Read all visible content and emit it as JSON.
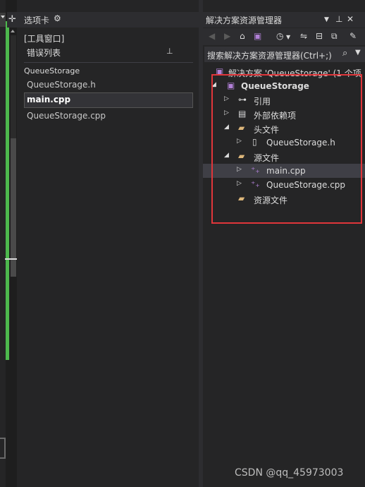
{
  "tabs_panel": {
    "title": "选项卡",
    "tool_group": "[工具窗口]",
    "error_list": "错误列表",
    "file_group": "QueueStorage",
    "tabs": [
      {
        "label": "QueueStorage.h"
      },
      {
        "label": "main.cpp",
        "active": true
      },
      {
        "label": "QueueStorage.cpp"
      }
    ]
  },
  "solution_explorer": {
    "title": "解决方案资源管理器",
    "search_placeholder": "搜索解决方案资源管理器(Ctrl+;)",
    "tree": {
      "solution": "解决方案 'QueueStorage' (1 个项",
      "project": "QueueStorage",
      "references": "引用",
      "external_deps": "外部依赖项",
      "headers": "头文件",
      "header_file": "QueueStorage.h",
      "sources": "源文件",
      "source_file_1": "main.cpp",
      "source_file_2": "QueueStorage.cpp",
      "resources": "资源文件"
    }
  },
  "watermark": "CSDN @qq_45973003",
  "colors": {
    "highlight_border": "#e0363a",
    "green_bar": "#4db84d",
    "cpp_icon": "#b180d7",
    "folder_icon": "#dcb67a"
  }
}
